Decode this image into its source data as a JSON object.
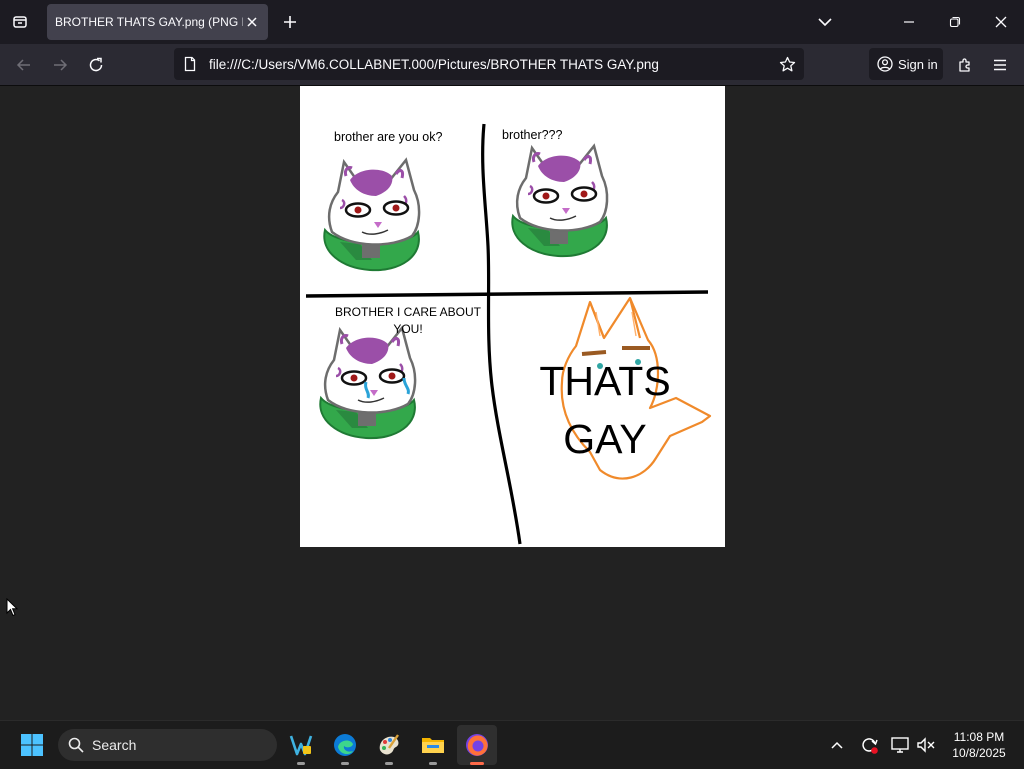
{
  "browser": {
    "tab": {
      "title": "BROTHER THATS GAY.png (PNG Image"
    },
    "url": "file:///C:/Users/VM6.COLLABNET.000/Pictures/BROTHER THATS GAY.png",
    "sign_in_label": "Sign in",
    "icons": [
      "list-all-tabs-icon",
      "close-tab-icon",
      "new-tab-icon",
      "chevron-down-icon",
      "minimize-icon",
      "restore-icon",
      "close-window-icon",
      "back-icon",
      "forward-icon",
      "reload-icon",
      "page-icon",
      "bookmark-star-icon",
      "account-icon",
      "extensions-icon",
      "menu-icon"
    ]
  },
  "image_content": {
    "panel1_caption": "brother are you ok?",
    "panel2_caption": "brother???",
    "panel3_caption": "BROTHER I CARE ABOUT YOU!",
    "panel4_caption_line1": "THATS",
    "panel4_caption_line2": "GAY"
  },
  "taskbar": {
    "search_placeholder": "Search",
    "apps": [
      "start-icon",
      "visual-studio-icon",
      "edge-icon",
      "paint-icon",
      "file-explorer-icon",
      "firefox-icon"
    ],
    "time": "11:08 PM",
    "date": "10/8/2025"
  },
  "colors": {
    "chrome_dark": "#1c1b22",
    "toolbar": "#2b2a33",
    "active_tab": "#42414d",
    "content_bg": "#222222",
    "taskbar": "#1c1c1c",
    "accent": "#ff6b4a"
  }
}
